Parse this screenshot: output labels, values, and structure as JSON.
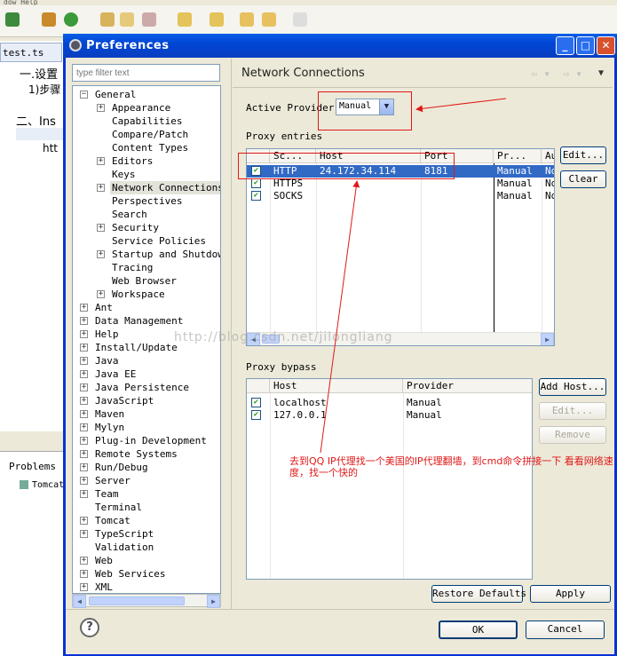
{
  "background": {
    "menu_text": "dow  Help",
    "editor_tab": "test.ts",
    "editor_lines": [
      "一.设置",
      "1)步骤",
      "二、Ins",
      "htt"
    ],
    "problems_tab": "Problems",
    "tomcat_item": "Tomcat"
  },
  "dialog": {
    "title": "Preferences",
    "filter_placeholder": "type filter text",
    "tree": [
      {
        "label": "General",
        "level": 0,
        "expander": "−"
      },
      {
        "label": "Appearance",
        "level": 1,
        "expander": "+"
      },
      {
        "label": "Capabilities",
        "level": 1,
        "expander": ""
      },
      {
        "label": "Compare/Patch",
        "level": 1,
        "expander": ""
      },
      {
        "label": "Content Types",
        "level": 1,
        "expander": ""
      },
      {
        "label": "Editors",
        "level": 1,
        "expander": "+"
      },
      {
        "label": "Keys",
        "level": 1,
        "expander": ""
      },
      {
        "label": "Network Connections",
        "level": 1,
        "expander": "+",
        "selected": true
      },
      {
        "label": "Perspectives",
        "level": 1,
        "expander": ""
      },
      {
        "label": "Search",
        "level": 1,
        "expander": ""
      },
      {
        "label": "Security",
        "level": 1,
        "expander": "+"
      },
      {
        "label": "Service Policies",
        "level": 1,
        "expander": ""
      },
      {
        "label": "Startup and Shutdown",
        "level": 1,
        "expander": "+"
      },
      {
        "label": "Tracing",
        "level": 1,
        "expander": ""
      },
      {
        "label": "Web Browser",
        "level": 1,
        "expander": ""
      },
      {
        "label": "Workspace",
        "level": 1,
        "expander": "+"
      },
      {
        "label": "Ant",
        "level": 0,
        "expander": "+"
      },
      {
        "label": "Data Management",
        "level": 0,
        "expander": "+"
      },
      {
        "label": "Help",
        "level": 0,
        "expander": "+"
      },
      {
        "label": "Install/Update",
        "level": 0,
        "expander": "+"
      },
      {
        "label": "Java",
        "level": 0,
        "expander": "+"
      },
      {
        "label": "Java EE",
        "level": 0,
        "expander": "+"
      },
      {
        "label": "Java Persistence",
        "level": 0,
        "expander": "+"
      },
      {
        "label": "JavaScript",
        "level": 0,
        "expander": "+"
      },
      {
        "label": "Maven",
        "level": 0,
        "expander": "+"
      },
      {
        "label": "Mylyn",
        "level": 0,
        "expander": "+"
      },
      {
        "label": "Plug-in Development",
        "level": 0,
        "expander": "+"
      },
      {
        "label": "Remote Systems",
        "level": 0,
        "expander": "+"
      },
      {
        "label": "Run/Debug",
        "level": 0,
        "expander": "+"
      },
      {
        "label": "Server",
        "level": 0,
        "expander": "+"
      },
      {
        "label": "Team",
        "level": 0,
        "expander": "+"
      },
      {
        "label": "Terminal",
        "level": 0,
        "expander": ""
      },
      {
        "label": "Tomcat",
        "level": 0,
        "expander": "+"
      },
      {
        "label": "TypeScript",
        "level": 0,
        "expander": "+"
      },
      {
        "label": "Validation",
        "level": 0,
        "expander": ""
      },
      {
        "label": "Web",
        "level": 0,
        "expander": "+"
      },
      {
        "label": "Web Services",
        "level": 0,
        "expander": "+"
      },
      {
        "label": "XML",
        "level": 0,
        "expander": "+"
      }
    ],
    "page_title": "Network Connections",
    "active_provider_label": "Active Provider:",
    "active_provider_value": "Manual",
    "proxy_entries_label": "Proxy entries",
    "proxy_columns": [
      "Sc...",
      "Host",
      "Port",
      "Pr...",
      "Au"
    ],
    "proxy_rows": [
      {
        "scheme": "HTTP",
        "host": "24.172.34.114",
        "port": "8181",
        "provider": "Manual",
        "auth": "No",
        "checked": true,
        "selected": true
      },
      {
        "scheme": "HTTPS",
        "host": "",
        "port": "",
        "provider": "Manual",
        "auth": "No",
        "checked": true,
        "selected": false
      },
      {
        "scheme": "SOCKS",
        "host": "",
        "port": "",
        "provider": "Manual",
        "auth": "No",
        "checked": true,
        "selected": false
      }
    ],
    "edit_button": "Edit...",
    "clear_button": "Clear",
    "proxy_bypass_label": "Proxy bypass",
    "bypass_columns": [
      "Host",
      "Provider"
    ],
    "bypass_rows": [
      {
        "host": "localhost",
        "provider": "Manual",
        "checked": true
      },
      {
        "host": "127.0.0.1",
        "provider": "Manual",
        "checked": true
      }
    ],
    "add_host_button": "Add Host...",
    "bypass_edit_button": "Edit...",
    "remove_button": "Remove",
    "restore_defaults_button": "Restore Defaults",
    "apply_button": "Apply",
    "ok_button": "OK",
    "cancel_button": "Cancel"
  },
  "annotation": {
    "text": "去到QQ IP代理找一个美国的IP代理翻墙，到cmd命令拼接一下 看看网络速度，找一个快的",
    "watermark": "http://blog.csdn.net/jilongliang",
    "color": "#e01818"
  }
}
